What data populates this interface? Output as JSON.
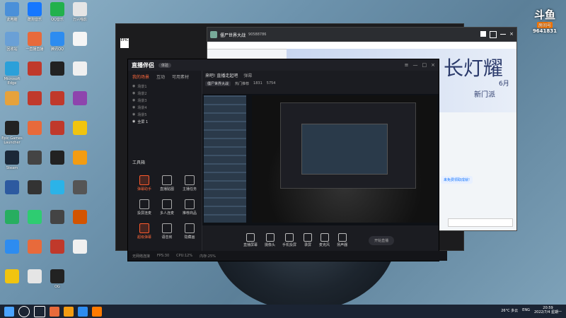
{
  "desktop_icons": [
    {
      "label": "此电脑",
      "col": 0,
      "row": 0,
      "color": "#4a90d9"
    },
    {
      "label": "酷狗音乐",
      "col": 1,
      "row": 0,
      "color": "#1677ff"
    },
    {
      "label": "QQ音乐",
      "col": 2,
      "row": 0,
      "color": "#22b14c"
    },
    {
      "label": "万兴喵影",
      "col": 3,
      "row": 0,
      "color": "#e5e5e5"
    },
    {
      "label": "回收站",
      "col": 0,
      "row": 1,
      "color": "#6aa0d6"
    },
    {
      "label": "一直播直播",
      "col": 1,
      "row": 1,
      "color": "#e86a3b"
    },
    {
      "label": "腾讯QQ",
      "col": 2,
      "row": 1,
      "color": "#2d8cf0"
    },
    {
      "label": "",
      "col": 3,
      "row": 1,
      "color": "#f5f5f5"
    },
    {
      "label": "Microsoft Edge",
      "col": 0,
      "row": 2,
      "color": "#2ba0d9"
    },
    {
      "label": "",
      "col": 1,
      "row": 2,
      "color": "#c0392b"
    },
    {
      "label": "",
      "col": 2,
      "row": 2,
      "color": "#222"
    },
    {
      "label": "",
      "col": 3,
      "row": 2,
      "color": "#f0f0f0"
    },
    {
      "label": "",
      "col": 0,
      "row": 3,
      "color": "#e6a23c"
    },
    {
      "label": "",
      "col": 1,
      "row": 3,
      "color": "#c0392b"
    },
    {
      "label": "",
      "col": 2,
      "row": 3,
      "color": "#c0392b"
    },
    {
      "label": "",
      "col": 3,
      "row": 3,
      "color": "#8e44ad"
    },
    {
      "label": "Epic Games Launcher",
      "col": 0,
      "row": 4,
      "color": "#222"
    },
    {
      "label": "",
      "col": 1,
      "row": 4,
      "color": "#e86a3b"
    },
    {
      "label": "",
      "col": 2,
      "row": 4,
      "color": "#c0392b"
    },
    {
      "label": "",
      "col": 3,
      "row": 4,
      "color": "#f1c40f"
    },
    {
      "label": "Steam",
      "col": 0,
      "row": 5,
      "color": "#1b2838"
    },
    {
      "label": "",
      "col": 1,
      "row": 5,
      "color": "#444"
    },
    {
      "label": "",
      "col": 2,
      "row": 5,
      "color": "#222"
    },
    {
      "label": "",
      "col": 3,
      "row": 5,
      "color": "#f39c12"
    },
    {
      "label": "",
      "col": 0,
      "row": 6,
      "color": "#2d5aa0"
    },
    {
      "label": "",
      "col": 1,
      "row": 6,
      "color": "#333"
    },
    {
      "label": "",
      "col": 2,
      "row": 6,
      "color": "#2bb3e8"
    },
    {
      "label": "",
      "col": 3,
      "row": 6,
      "color": "#555"
    },
    {
      "label": "",
      "col": 0,
      "row": 7,
      "color": "#27ae60"
    },
    {
      "label": "",
      "col": 1,
      "row": 7,
      "color": "#2ecc71"
    },
    {
      "label": "",
      "col": 2,
      "row": 7,
      "color": "#444"
    },
    {
      "label": "",
      "col": 3,
      "row": 7,
      "color": "#d35400"
    },
    {
      "label": "",
      "col": 0,
      "row": 8,
      "color": "#2d8cf0"
    },
    {
      "label": "",
      "col": 1,
      "row": 8,
      "color": "#e86a3b"
    },
    {
      "label": "",
      "col": 2,
      "row": 8,
      "color": "#c0392b"
    },
    {
      "label": "",
      "col": 3,
      "row": 8,
      "color": "#f0f0f0"
    },
    {
      "label": "",
      "col": 0,
      "row": 9,
      "color": "#f1c40f"
    },
    {
      "label": "",
      "col": 1,
      "row": 9,
      "color": "#e5e5e5"
    },
    {
      "label": "OG",
      "col": 2,
      "row": 9,
      "color": "#222"
    }
  ],
  "douyu": {
    "brand": "斗鱼",
    "room_label": "房间号",
    "room_id": "9641831"
  },
  "browser": {
    "tab_title": "僵尸世界大战",
    "number": "90588786",
    "banner_text": "长灯耀",
    "date_text": "6月",
    "subtitle": "新门派",
    "chat_line": "来免费领取成就!"
  },
  "app": {
    "name": "直播伴侣",
    "badge": "体验",
    "tabs": [
      "我的场景",
      "互动",
      "可用素材"
    ],
    "scenes": [
      "场景1",
      "场景2",
      "场景3",
      "场景4",
      "场景5"
    ],
    "active_scene": "全屏 1",
    "tools_title": "工具箱",
    "tools": [
      "弹幕助手",
      "直播贴图",
      "主播任务",
      "投屏连麦",
      "多人连麦",
      "推荐商品",
      "超级弹幕",
      "语音房",
      "隐藏画"
    ],
    "channel": "来吧! 直播走起吧",
    "channel_tab": "弹幕",
    "meta_tag": "僵尸世界大战",
    "meta_b": "热门推荐",
    "meta_c": "1831",
    "meta_d": "5754",
    "bottom": [
      "直播屏幕",
      "摄像头",
      "手机投屏",
      "录屏",
      "麦克风",
      "扬声器"
    ],
    "start": "开始直播",
    "status": [
      "无网络连接",
      "FPS:30",
      "CPU:12%",
      "内存:25%"
    ]
  },
  "taskbar": {
    "weather": "26°C 多云",
    "ime": "ENG",
    "time": "20:59",
    "date": "2022/7/4 星期一"
  }
}
